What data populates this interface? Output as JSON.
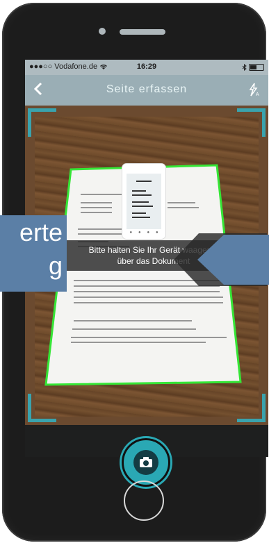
{
  "status_bar": {
    "carrier": "●●●○○ Vodafone.de",
    "wifi_icon": "wifi-icon",
    "time": "16:29",
    "bluetooth_icon": "bluetooth-icon"
  },
  "nav_bar": {
    "back_icon": "chevron-left-icon",
    "title": "Seite erfassen",
    "auto_icon": "auto-capture-icon"
  },
  "hint": {
    "line1": "Bitte halten Sie Ihr Gerät waagerec",
    "line2": "über das Dokument"
  },
  "overlay_left": {
    "line1": "erte",
    "line2": "g"
  },
  "camera": {
    "shutter_icon": "camera-icon"
  },
  "colors": {
    "accent": "#2aa8b4",
    "nav_bg": "#9aaeb5",
    "detection_border": "#35e636",
    "overlay_blue": "#5b7fa6"
  }
}
